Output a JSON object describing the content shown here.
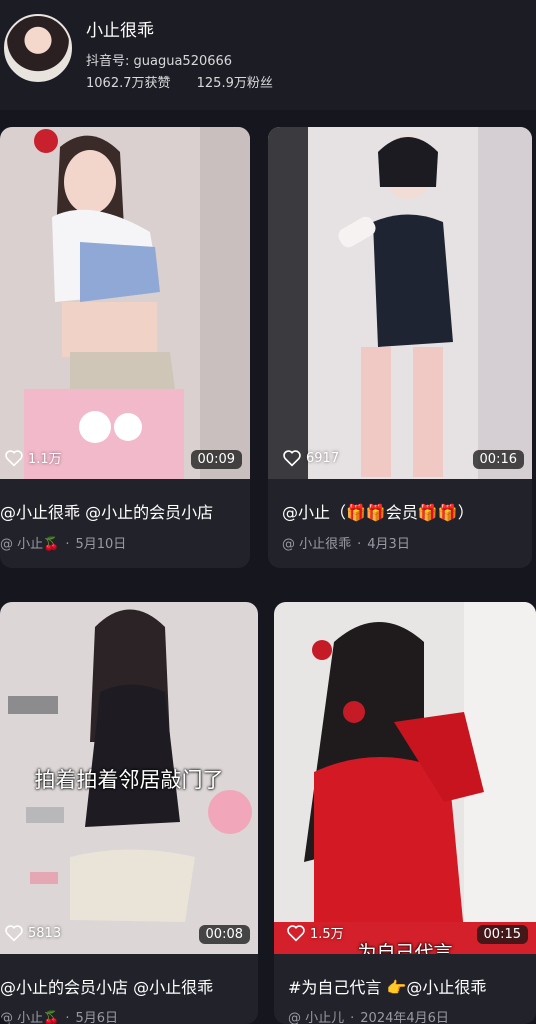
{
  "profile": {
    "name": "小止很乖",
    "account": "抖音号: guagua520666",
    "likes": "1062.7万获赞",
    "fans": "125.9万粉丝"
  },
  "videos": [
    {
      "likes": "1.1万",
      "duration": "00:09",
      "title": "@小止很乖 @小止的会员小店",
      "author": "@ 小止🍒",
      "date": "5月10日"
    },
    {
      "likes": "6917",
      "duration": "00:16",
      "title": "@小止（🎁🎁会员🎁🎁）",
      "author": "@ 小止很乖",
      "date": "4月3日"
    },
    {
      "likes": "5813",
      "duration": "00:08",
      "overlay": "拍着拍着邻居敲门了",
      "title": "@小止的会员小店 @小止很乖",
      "author": "@ 小止🍒",
      "date": "5月6日"
    },
    {
      "likes": "1.5万",
      "duration": "00:15",
      "overlay": "为自己代言",
      "title": "#为自己代言 👉@小止很乖",
      "author": "@ 小止儿",
      "date": "2024年4月6日"
    }
  ],
  "icons": {
    "heart": "heart-icon",
    "avatar": "avatar"
  }
}
